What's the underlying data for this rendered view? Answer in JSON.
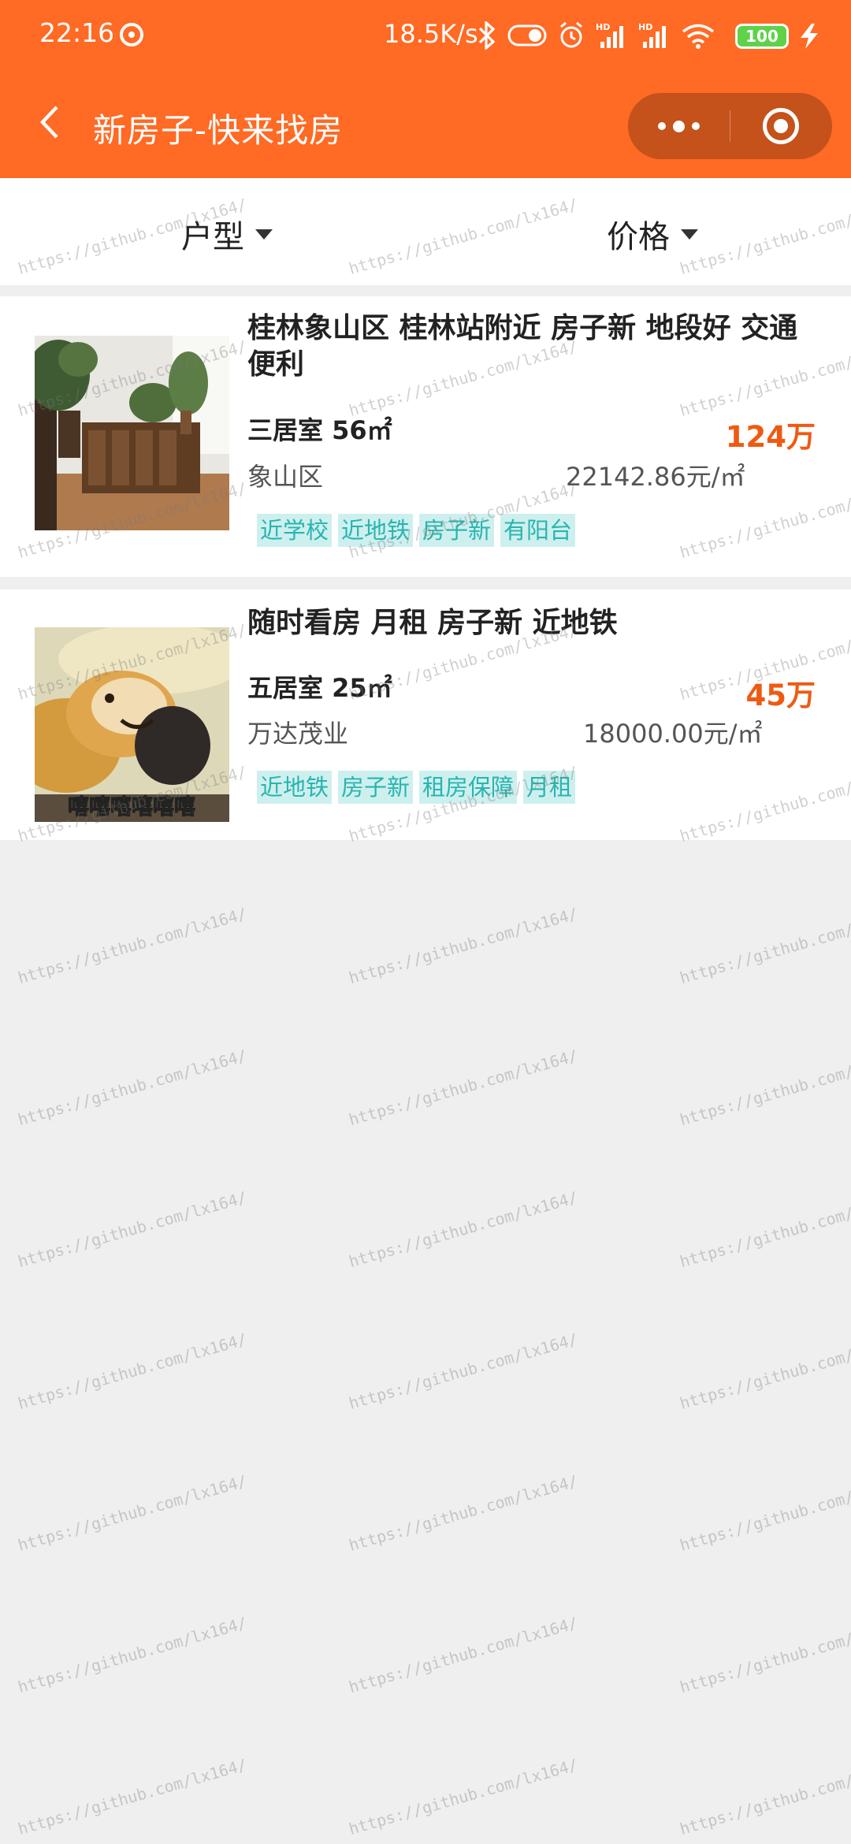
{
  "status_bar": {
    "time": "22:16",
    "network_speed": "18.5K/s",
    "battery": "100",
    "icons": [
      "swirl-icon",
      "bluetooth-icon",
      "toggle-icon",
      "alarm-icon",
      "signal-hd-icon",
      "signal-hd-icon",
      "wifi-icon",
      "battery-icon",
      "charging-icon"
    ]
  },
  "nav": {
    "title": "新房子-快来找房",
    "back_icon": "chevron-left-icon",
    "more_icon": "more-dots-icon",
    "close_icon": "target-close-icon"
  },
  "filters": [
    {
      "label": "户型"
    },
    {
      "label": "价格"
    }
  ],
  "listings": [
    {
      "title": "桂林象山区 桂林站附近 房子新 地段好 交通便利",
      "rooms": "三居室 56㎡",
      "price": "124万",
      "district": "象山区",
      "unit_price": "22142.86元/㎡",
      "tags": [
        "近学校",
        "近地铁",
        "房子新",
        "有阳台"
      ]
    },
    {
      "title": "随时看房 月租 房子新 近地铁",
      "rooms": "五居室 25㎡",
      "price": "45万",
      "district": "万达茂业",
      "unit_price": "18000.00元/㎡",
      "tags": [
        "近地铁",
        "房子新",
        "租房保障",
        "月租"
      ],
      "image_caption": "嘻嘻嘻嘻嘻嘻"
    }
  ],
  "watermark": "https://github.com/lx164/",
  "colors": {
    "header": "#ff6a24",
    "price": "#ef5a13",
    "tag_bg": "#cdf0ee",
    "tag_text": "#2ab4b0",
    "page_bg": "#efefef"
  }
}
